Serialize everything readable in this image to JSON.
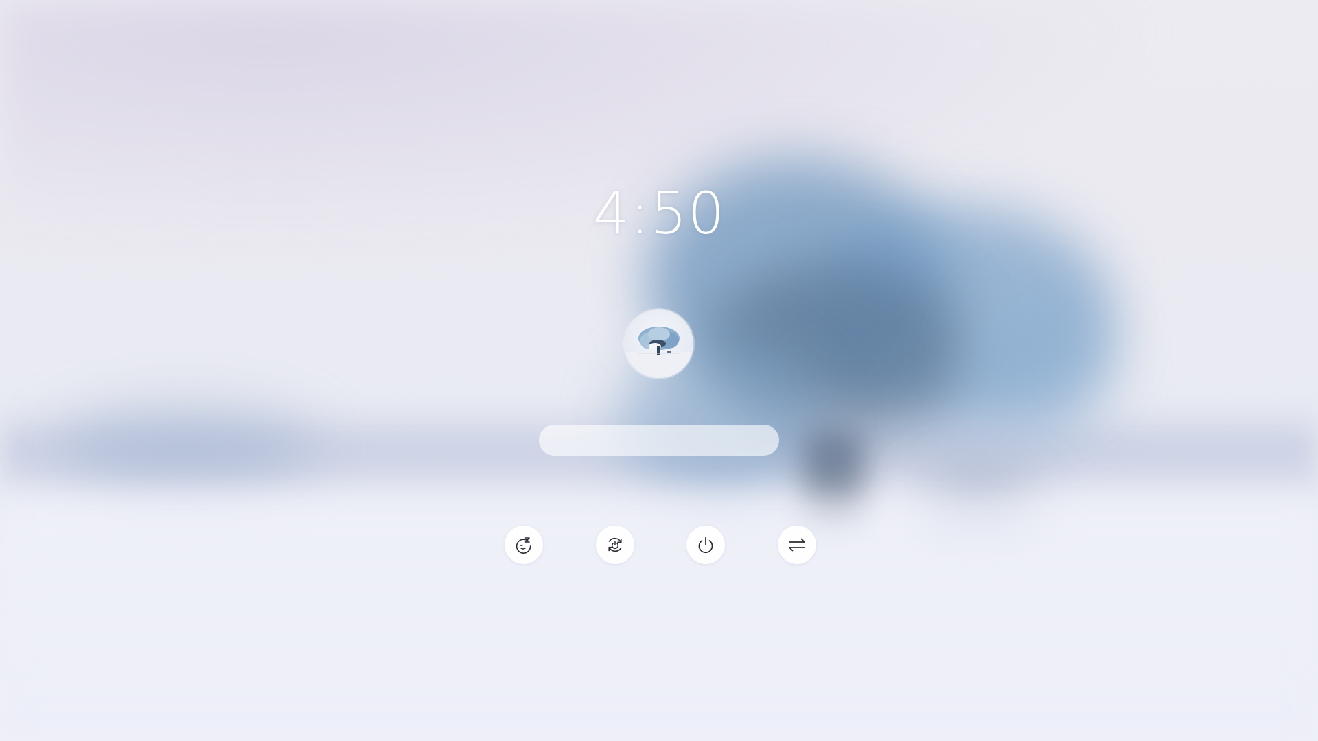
{
  "lockscreen": {
    "time": "4:50",
    "password": {
      "value": "",
      "placeholder": ""
    },
    "avatar": {
      "icon": "snowy-tree-avatar"
    }
  },
  "actions": [
    {
      "id": "sleep",
      "icon": "sleep-icon"
    },
    {
      "id": "restart",
      "icon": "restart-icon"
    },
    {
      "id": "shutdown",
      "icon": "power-icon"
    },
    {
      "id": "switch-user",
      "icon": "switch-user-icon"
    }
  ],
  "colors": {
    "clock_text": "#ffffff",
    "button_bg": "#ffffff",
    "icon_stroke": "#2b2b33",
    "background": "#ebebf2",
    "tree": "#7a9cc0"
  }
}
